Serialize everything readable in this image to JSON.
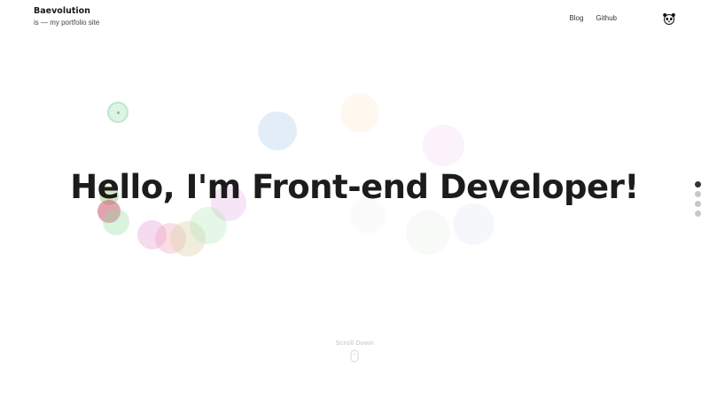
{
  "header": {
    "brand_title": "Baevolution",
    "brand_tagline": "is — my portfolio site",
    "nav": [
      {
        "label": "Blog"
      },
      {
        "label": "Github"
      }
    ],
    "nav_icon": "panda-icon"
  },
  "hero": {
    "headline": "Hello, I'm Front-end Developer!"
  },
  "section_nav": {
    "count": 4,
    "active_index": 0
  },
  "scroll_hint": {
    "label": "Scroll Down",
    "icon": "mouse-icon"
  },
  "colors": {
    "text": "#1c1c1c",
    "background": "#ffffff",
    "dot_active": "#333333",
    "dot_inactive": "#c8c8c8",
    "scroll_text": "#d4d4d4"
  }
}
